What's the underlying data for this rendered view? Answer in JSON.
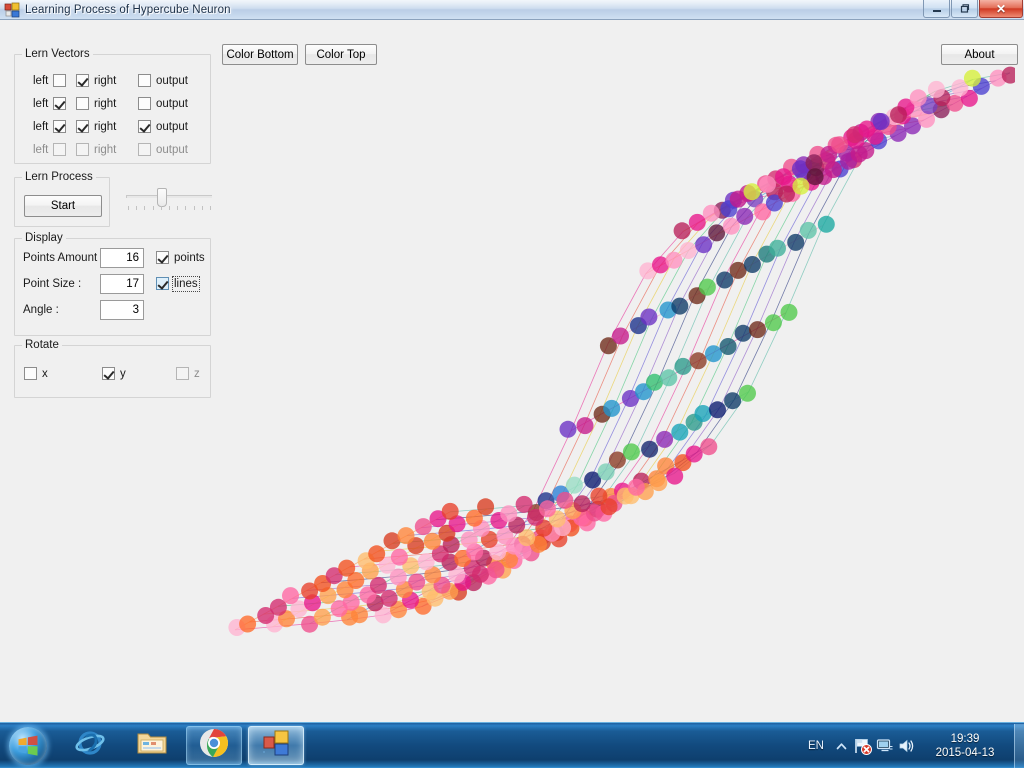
{
  "window": {
    "title": "Learning Process of Hypercube Neuron",
    "icon": "app-icon",
    "minimize_label": "–",
    "restore_label": "❐",
    "close_label": "✕"
  },
  "toolbar": {
    "color_bottom_label": "Color Bottom",
    "color_top_label": "Color Top",
    "about_label": "About"
  },
  "lern_vectors": {
    "legend": "Lern Vectors",
    "rows": [
      {
        "left_label": "left",
        "left_checked": false,
        "right_label": "right",
        "right_checked": true,
        "output_label": "output",
        "output_checked": false,
        "disabled": false
      },
      {
        "left_label": "left",
        "left_checked": true,
        "right_label": "right",
        "right_checked": false,
        "output_label": "output",
        "output_checked": false,
        "disabled": false
      },
      {
        "left_label": "left",
        "left_checked": true,
        "right_label": "right",
        "right_checked": true,
        "output_label": "output",
        "output_checked": true,
        "disabled": false
      },
      {
        "left_label": "left",
        "left_checked": false,
        "right_label": "right",
        "right_checked": false,
        "output_label": "output",
        "output_checked": false,
        "disabled": true
      }
    ]
  },
  "lern_process": {
    "legend": "Lern Process",
    "start_label": "Start",
    "slider": {
      "value_percent": 38,
      "tick_count": 11
    }
  },
  "display": {
    "legend": "Display",
    "points_amount_label": "Points Amount :",
    "points_amount_value": "16",
    "point_size_label": "Point Size :",
    "point_size_value": "17",
    "angle_label": "Angle :",
    "angle_value": "3",
    "points_checkbox_label": "points",
    "points_checked": true,
    "lines_checkbox_label": "lines",
    "lines_checked": true,
    "lines_focused": true
  },
  "rotate": {
    "legend": "Rotate",
    "axes": [
      {
        "label": "x",
        "checked": false,
        "disabled": false
      },
      {
        "label": "y",
        "checked": true,
        "disabled": false
      },
      {
        "label": "z",
        "checked": false,
        "disabled": true
      }
    ]
  },
  "plot": {
    "background": "#f2f2f2",
    "grid_rows": 16,
    "grid_cols": 16,
    "point_size": 17,
    "point_opacity": 0.78,
    "line_opacity": 0.55,
    "palette": [
      "#e8168a",
      "#d42a6e",
      "#b8205a",
      "#f04d8c",
      "#ff66a3",
      "#ff8fbf",
      "#ffb3d1",
      "#e8402a",
      "#d93b1f",
      "#f2501e",
      "#ff6a2a",
      "#ff8438",
      "#ffa04d",
      "#ffbc6b",
      "#e8c21e",
      "#f0d83a",
      "#e8e83a",
      "#d6f03a",
      "#b0e83a",
      "#84d93a",
      "#4fc94a",
      "#2fbf6e",
      "#22b58c",
      "#19a8a0",
      "#17a3b8",
      "#1f93cc",
      "#2a7fd6",
      "#3a63d6",
      "#4a3fd0",
      "#6a2fc4",
      "#8a26b5",
      "#a81fa0",
      "#c41a8c",
      "#8a1f5a",
      "#5c1538",
      "#7a3fbf",
      "#9a6fd0",
      "#b08fe0",
      "#c4a8ea",
      "#9aa8b5",
      "#b5bcc4",
      "#c8ced4",
      "#0a1a6e",
      "#12246e",
      "#1a2f8a",
      "#0d3a66",
      "#12566e",
      "#1a7a7a",
      "#2a9a8a",
      "#3fb09a",
      "#5cc4a8",
      "#7ad0b5",
      "#98dcc4",
      "#6e2a18",
      "#8a3a22",
      "#a64d2e"
    ],
    "surface_description": "3D sigmoid learning surface with 16x16 colored point grid"
  },
  "taskbar": {
    "start_label": "Start",
    "items": [
      {
        "name": "internet-explorer",
        "state": "pinned"
      },
      {
        "name": "windows-explorer",
        "state": "pinned"
      },
      {
        "name": "google-chrome",
        "state": "running"
      },
      {
        "name": "hypercube-neuron",
        "state": "active"
      }
    ],
    "tray": {
      "language": "EN",
      "show_hidden_label": "▲",
      "icons": [
        "action-center-flag-icon",
        "network-icon",
        "volume-icon"
      ],
      "time": "19:39",
      "date": "2015-04-13"
    }
  }
}
